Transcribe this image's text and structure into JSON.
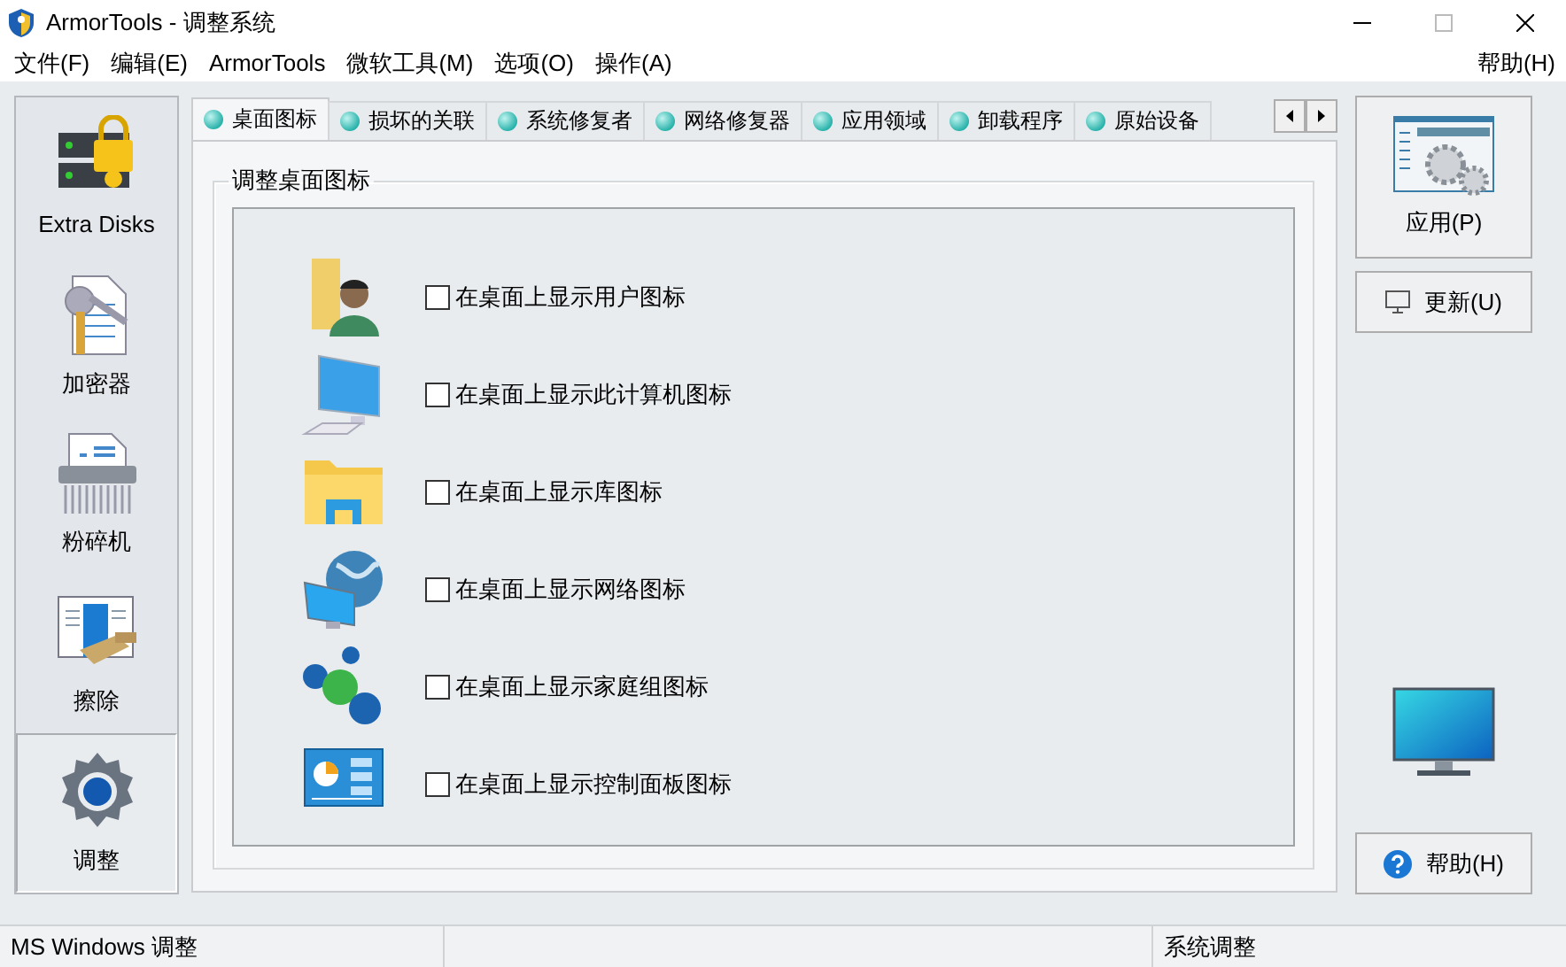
{
  "window": {
    "title": "ArmorTools - 调整系统"
  },
  "menu": {
    "items": [
      "文件(F)",
      "编辑(E)",
      "ArmorTools",
      "微软工具(M)",
      "选项(O)",
      "操作(A)"
    ],
    "help": "帮助(H)"
  },
  "sidebar": {
    "items": [
      {
        "label": "Extra Disks",
        "selected": false
      },
      {
        "label": "加密器",
        "selected": false
      },
      {
        "label": "粉碎机",
        "selected": false
      },
      {
        "label": "擦除",
        "selected": false
      },
      {
        "label": "调整",
        "selected": true
      }
    ]
  },
  "tabs": [
    {
      "label": "桌面图标",
      "selected": true
    },
    {
      "label": "损坏的关联",
      "selected": false
    },
    {
      "label": "系统修复者",
      "selected": false
    },
    {
      "label": "网络修复器",
      "selected": false
    },
    {
      "label": "应用领域",
      "selected": false
    },
    {
      "label": "卸载程序",
      "selected": false
    },
    {
      "label": "原始设备",
      "selected": false
    }
  ],
  "group": {
    "title": "调整桌面图标",
    "options": [
      {
        "label": "在桌面上显示用户图标",
        "checked": false
      },
      {
        "label": "在桌面上显示此计算机图标",
        "checked": false
      },
      {
        "label": "在桌面上显示库图标",
        "checked": false
      },
      {
        "label": "在桌面上显示网络图标",
        "checked": false
      },
      {
        "label": "在桌面上显示家庭组图标",
        "checked": false
      },
      {
        "label": "在桌面上显示控制面板图标",
        "checked": false
      }
    ]
  },
  "actions": {
    "apply": "应用(P)",
    "update": "更新(U)",
    "help": "帮助(H)"
  },
  "status_bar": {
    "left": "MS Windows 调整",
    "right": "系统调整"
  }
}
